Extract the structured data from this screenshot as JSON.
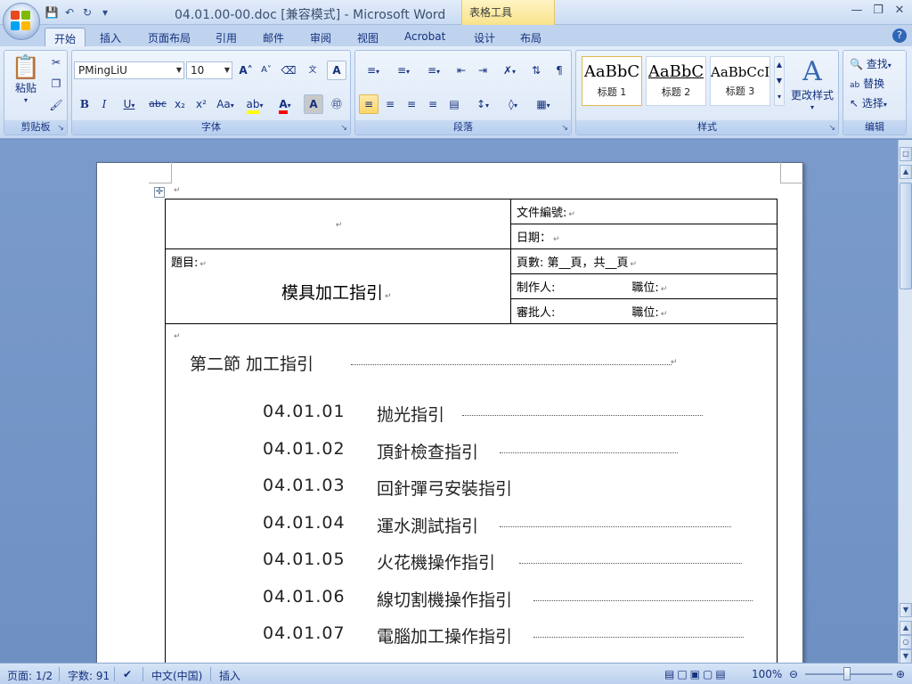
{
  "titlebar": {
    "title": "04.01.00-00.doc [兼容模式] - Microsoft Word",
    "context_tab": "表格工具"
  },
  "tabs": [
    "开始",
    "插入",
    "页面布局",
    "引用",
    "邮件",
    "审阅",
    "视图",
    "Acrobat",
    "设计",
    "布局"
  ],
  "ribbon": {
    "clipboard": {
      "paste_label": "粘贴",
      "group_label": "剪贴板"
    },
    "font": {
      "font_name": "PMingLiU",
      "font_size": "10",
      "group_label": "字体"
    },
    "paragraph": {
      "group_label": "段落"
    },
    "styles": {
      "items": [
        {
          "sample": "AaBbC",
          "name": "标题 1"
        },
        {
          "sample": "AaBbC",
          "name": "标题 2"
        },
        {
          "sample": "AaBbCcI",
          "name": "标题 3"
        }
      ],
      "change_styles": "更改样式",
      "group_label": "样式"
    },
    "editing": {
      "find": "查找",
      "replace": "替换",
      "select": "选择",
      "group_label": "编辑"
    }
  },
  "document": {
    "header_table": {
      "doc_no": "文件編號:",
      "date": "日期：",
      "subject_label": "題目:",
      "subject": "模具加工指引",
      "pages": "頁數: 第__頁，共__頁",
      "author": "制作人:",
      "author_position": "職位:",
      "approver": "審批人:",
      "approver_position": "職位:"
    },
    "section": "第二節   加工指引",
    "toc": [
      {
        "num": "04.01.01",
        "title": "抛光指引"
      },
      {
        "num": "04.01.02",
        "title": "頂針檢查指引"
      },
      {
        "num": "04.01.03",
        "title": "回針彈弓安裝指引"
      },
      {
        "num": "04.01.04",
        "title": "運水測試指引"
      },
      {
        "num": "04.01.05",
        "title": "火花機操作指引"
      },
      {
        "num": "04.01.06",
        "title": "線切割機操作指引"
      },
      {
        "num": "04.01.07",
        "title": "電腦加工操作指引"
      }
    ]
  },
  "statusbar": {
    "page": "页面: 1/2",
    "words": "字数: 91",
    "language": "中文(中国)",
    "mode": "插入",
    "zoom": "100%"
  }
}
